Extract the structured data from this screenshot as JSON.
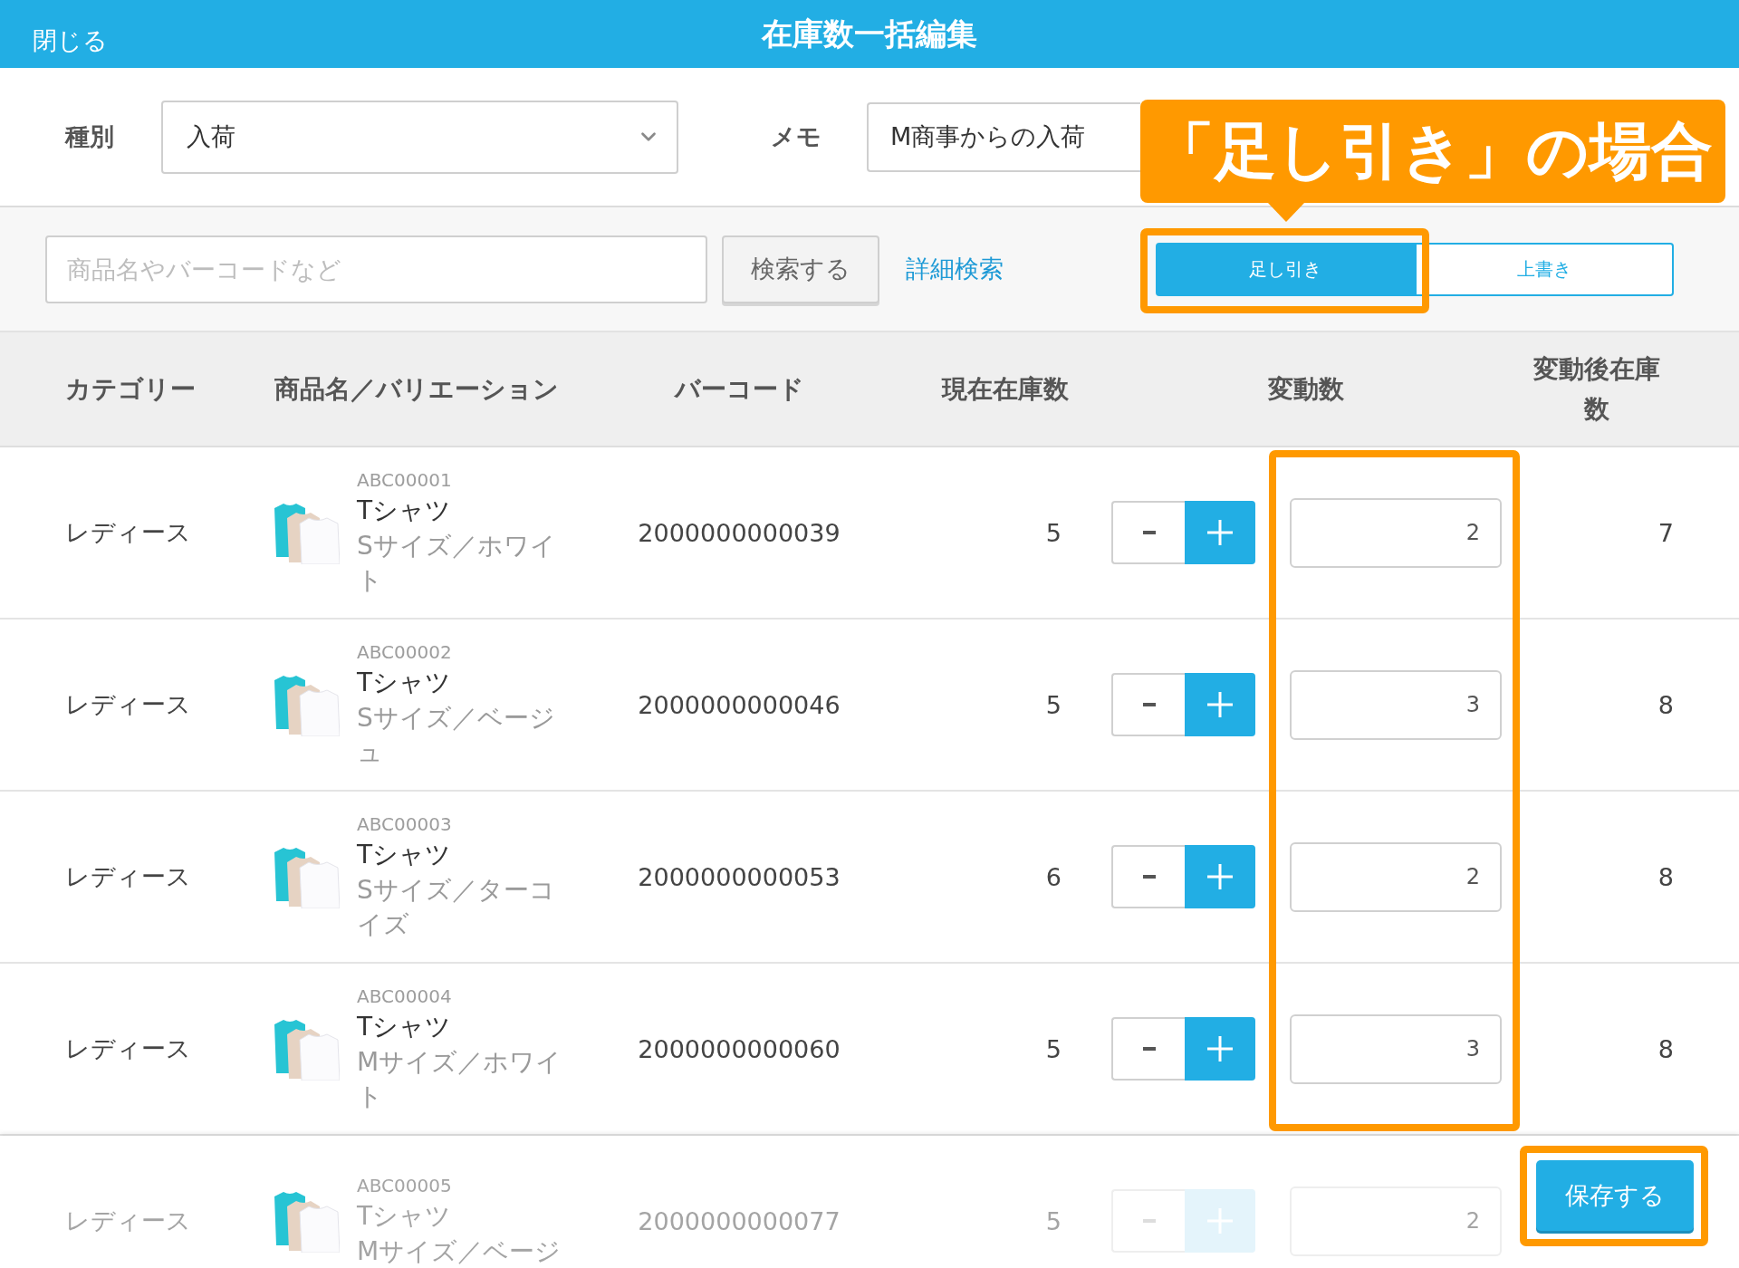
{
  "top_bar": {
    "close": "閉じる",
    "title": "在庫数一括編集"
  },
  "form": {
    "type_label": "種別",
    "type_value": "入荷",
    "memo_label": "メモ",
    "memo_value": "M商事からの入荷"
  },
  "search": {
    "placeholder": "商品名やバーコードなど",
    "button": "検索する",
    "advanced_link": "詳細検索"
  },
  "mode_tabs": [
    {
      "label": "足し引き",
      "selected": true
    },
    {
      "label": "上書き",
      "selected": false
    }
  ],
  "table": {
    "columns": [
      "カテゴリー",
      "商品名／バリエーション",
      "バーコード",
      "現在在庫数",
      "変動数",
      "変動後在庫数"
    ],
    "rows": [
      {
        "category": "レディース",
        "code": "ABC00001",
        "name": "Tシャツ",
        "variation": "Sサイズ／ホワイト",
        "barcode": "2000000000039",
        "stock": "5",
        "change": "2",
        "after": "7",
        "dimmed": false
      },
      {
        "category": "レディース",
        "code": "ABC00002",
        "name": "Tシャツ",
        "variation": "Sサイズ／ベージュ",
        "barcode": "2000000000046",
        "stock": "5",
        "change": "3",
        "after": "8",
        "dimmed": false
      },
      {
        "category": "レディース",
        "code": "ABC00003",
        "name": "Tシャツ",
        "variation": "Sサイズ／ターコイズ",
        "barcode": "2000000000053",
        "stock": "6",
        "change": "2",
        "after": "8",
        "dimmed": false
      },
      {
        "category": "レディース",
        "code": "ABC00004",
        "name": "Tシャツ",
        "variation": "Mサイズ／ホワイト",
        "barcode": "2000000000060",
        "stock": "5",
        "change": "3",
        "after": "8",
        "dimmed": false
      },
      {
        "category": "レディース",
        "code": "ABC00005",
        "name": "Tシャツ",
        "variation": "Mサイズ／ベージ",
        "barcode": "2000000000077",
        "stock": "5",
        "change": "2",
        "dimmed": true
      }
    ]
  },
  "footer": {
    "save_button": "保存する"
  },
  "annotations": [
    {
      "kind": "callout",
      "text": "「足し引き」の場合"
    },
    {
      "kind": "frame"
    },
    {
      "kind": "frame"
    },
    {
      "kind": "frame"
    }
  ]
}
